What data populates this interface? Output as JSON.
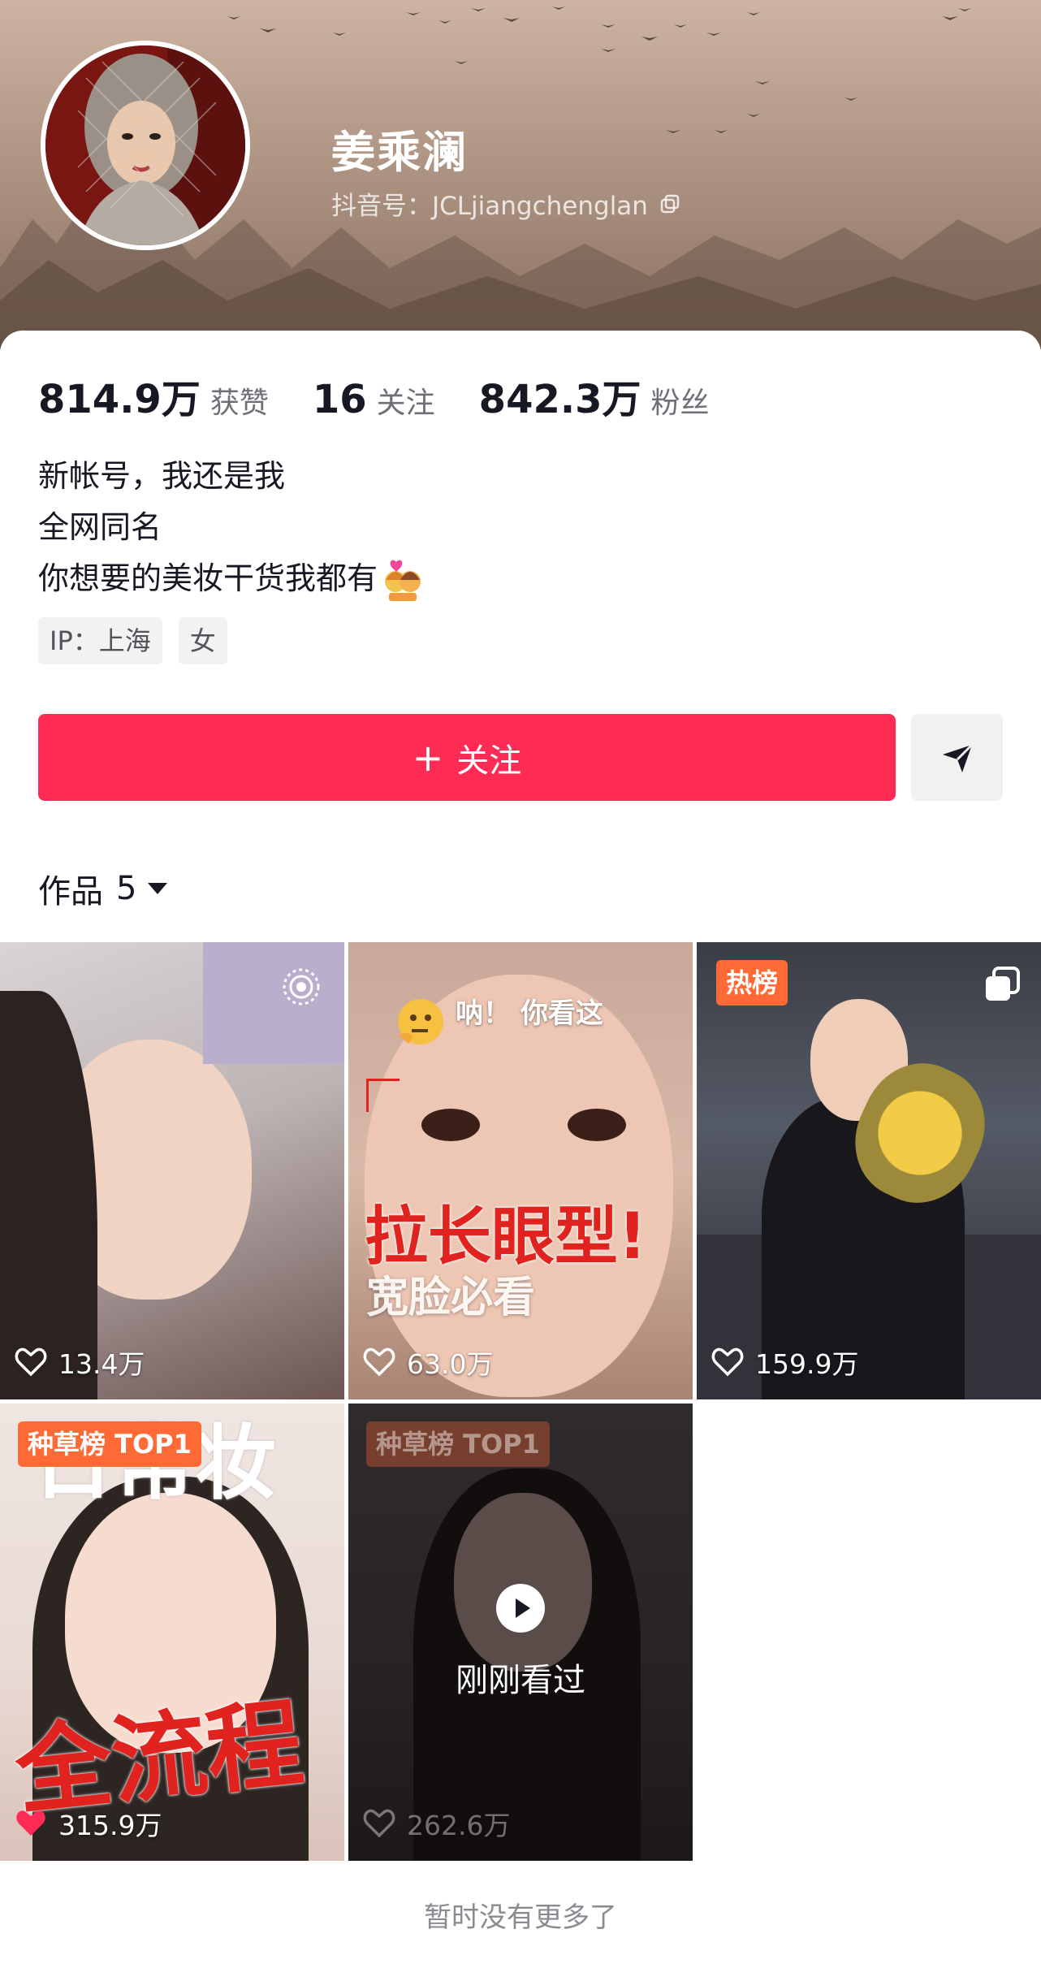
{
  "profile": {
    "name": "姜乘澜",
    "douyin_id": "抖音号：JCLjiangchenglan"
  },
  "stats": [
    {
      "value": "814.9万",
      "label": "获赞"
    },
    {
      "value": "16",
      "label": "关注"
    },
    {
      "value": "842.3万",
      "label": "粉丝"
    }
  ],
  "bio": {
    "line1": "新帐号，我还是我",
    "line2": "全网同名",
    "line3": "你想要的美妆干货我都有"
  },
  "tags": [
    "IP：上海",
    "女"
  ],
  "actions": {
    "follow_plus": "+",
    "follow_label": "关注"
  },
  "works": {
    "label": "作品",
    "count": "5"
  },
  "videos": [
    {
      "likes": "13.4万"
    },
    {
      "likes": "63.0万",
      "caption_top": "呐！ 你看这",
      "title": "拉长眼型!",
      "subtitle": "宽脸必看"
    },
    {
      "likes": "159.9万",
      "badge": "热榜"
    },
    {
      "likes": "315.9万",
      "badge": "种草榜 TOP1",
      "title_top": "日常妆",
      "title": "全流程"
    },
    {
      "likes": "262.6万",
      "badge": "种草榜 TOP1",
      "overlay": "刚刚看过"
    }
  ],
  "footer": {
    "end_text": "暂时没有更多了"
  },
  "colors": {
    "accent": "#fe2c55",
    "hot_badge": "#fe6a35"
  }
}
